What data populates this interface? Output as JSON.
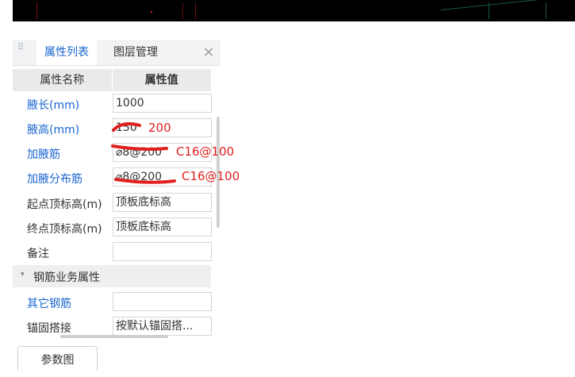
{
  "tabs": [
    {
      "label": "属性列表",
      "active": true
    },
    {
      "label": "图层管理",
      "active": false
    }
  ],
  "close_glyph": "×",
  "grip_glyph": "⠿",
  "table": {
    "headers": [
      "属性名称",
      "属性值"
    ],
    "rows": [
      {
        "label": "腋长(mm)",
        "value": "1000",
        "link": true
      },
      {
        "label": "腋高(mm)",
        "value": "150",
        "link": true
      },
      {
        "label": "加腋筋",
        "value": "⌀8@200",
        "link": true
      },
      {
        "label": "加腋分布筋",
        "value": "⌀8@200",
        "link": true
      },
      {
        "label": "起点顶标高(m)",
        "value": "顶板底标高",
        "link": false
      },
      {
        "label": "终点顶标高(m)",
        "value": "顶板底标高",
        "link": false
      },
      {
        "label": "备注",
        "value": "",
        "link": false
      }
    ],
    "group": {
      "label": "钢筋业务属性",
      "caret": "▾"
    },
    "group_rows": [
      {
        "label": "其它钢筋",
        "value": "",
        "link": true
      },
      {
        "label": "锚固搭接",
        "value": "按默认锚固搭...",
        "link": false
      }
    ]
  },
  "bottom_tab": "参数图",
  "annotations": [
    "200",
    "C16@100",
    "C16@100"
  ],
  "colors": {
    "accent": "#1a66d0",
    "annotation": "#e02020",
    "header_bg": "#e9eaec"
  }
}
